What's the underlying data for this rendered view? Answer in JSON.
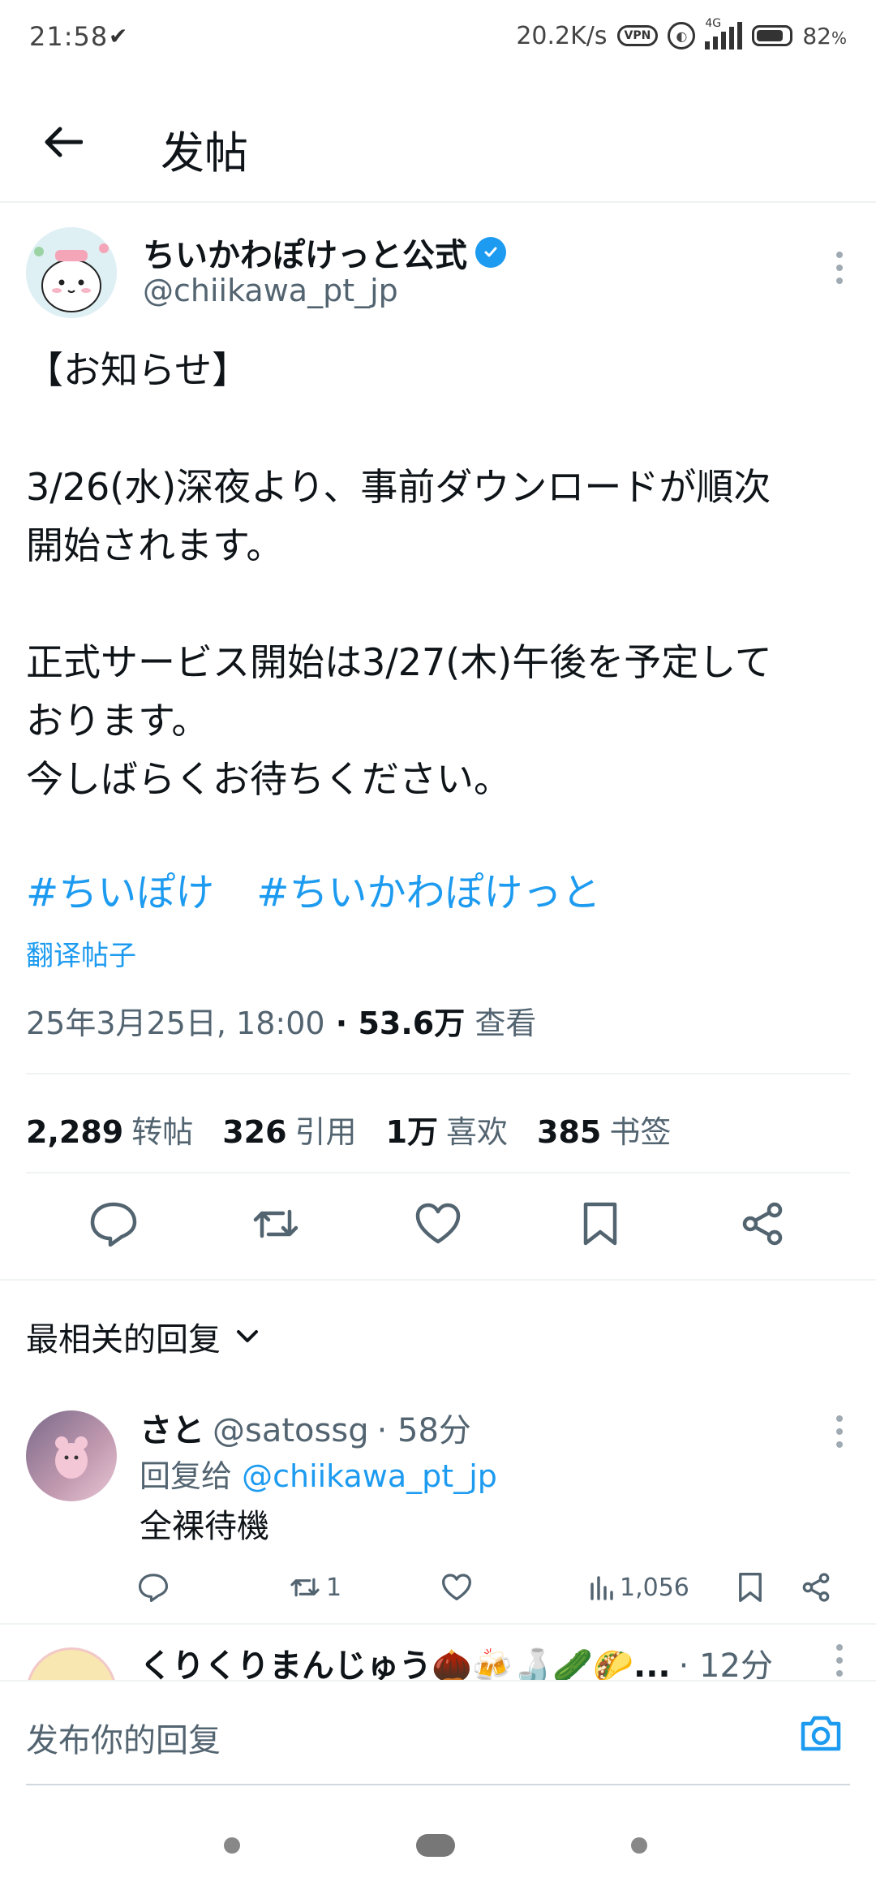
{
  "status_bar": {
    "time": "21:58",
    "time_icon": "check-mark",
    "net_speed": "20.2K/s",
    "vpn_label": "VPN",
    "network_type": "4G",
    "battery": "82",
    "battery_unit": "%",
    "battery_level": 0.82
  },
  "app_bar": {
    "title": "发帖"
  },
  "post": {
    "author_name": "ちいかわぽけっと公式",
    "author_handle": "@chiikawa_pt_jp",
    "body": [
      "【お知らせ】",
      "",
      "3/26(水)深夜より、事前ダウンロードが順次\n開始されます。",
      "",
      "正式サービス開始は3/27(木)午後を予定して\nおります。\n今しばらくお待ちください。"
    ],
    "hashtags": [
      "#ちいぽけ",
      "#ちいかわぽけっと"
    ],
    "translate_label": "翻译帖子",
    "timestamp": "25年3月25日, 18:00",
    "separator": " · ",
    "views_count": "53.6万",
    "views_label": " 查看",
    "stats": [
      {
        "count": "2,289",
        "label": "转帖"
      },
      {
        "count": "326",
        "label": "引用"
      },
      {
        "count": "1万",
        "label": "喜欢"
      },
      {
        "count": "385",
        "label": "书签"
      }
    ]
  },
  "replies_sort": {
    "label": "最相关的回复"
  },
  "replies": [
    {
      "name": "さと",
      "handle": "@satossg",
      "time": "· 58分",
      "reply_to_prefix": "回复给 ",
      "reply_to_handle": "@chiikawa_pt_jp",
      "text": "全裸待機",
      "retweets": "1",
      "views": "1,056"
    },
    {
      "name": "くりくりまんじゅう🌰🍻🍶🥒🌮...",
      "time": "· 12分"
    }
  ],
  "composer": {
    "placeholder": "发布你的回复"
  },
  "colors": {
    "accent": "#1d9bf0",
    "text": "#0f1419",
    "muted": "#536471"
  }
}
